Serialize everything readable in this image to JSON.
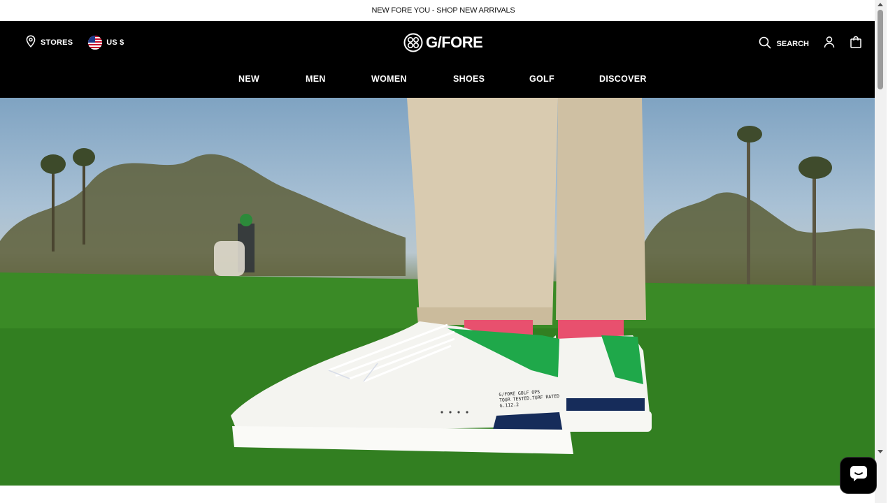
{
  "announcement": "NEW FORE YOU - SHOP NEW ARRIVALS",
  "header": {
    "stores_label": "STORES",
    "currency_label": "US $",
    "logo_text": "G/FORE",
    "search_label": "SEARCH"
  },
  "nav": [
    "NEW",
    "MEN",
    "WOMEN",
    "SHOES",
    "GOLF",
    "DISCOVER"
  ],
  "hero": {
    "shoe_print": [
      "G/FORE GOLF OPS",
      "TOUR TESTED.TURF RATED",
      "G.112.2"
    ]
  },
  "icons": {
    "stores": "map-pin-icon",
    "currency": "us-flag-icon",
    "search": "search-icon",
    "account": "user-icon",
    "bag": "shopping-bag-icon",
    "chat": "chat-icon"
  },
  "colors": {
    "header_bg": "#000000",
    "header_text": "#ffffff",
    "accent_green": "#1fa84a",
    "sock_pink": "#e8506e"
  }
}
